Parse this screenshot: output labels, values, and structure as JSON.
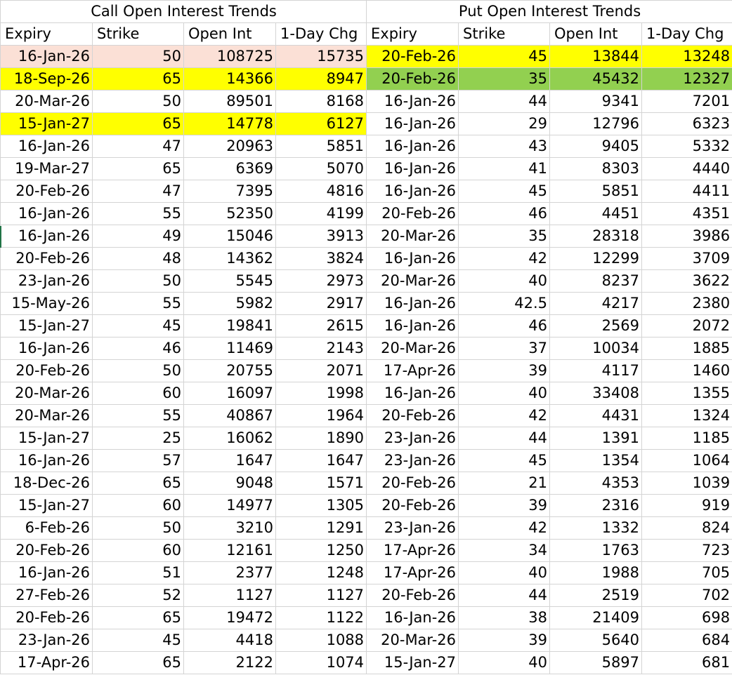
{
  "sections": {
    "call_title": "Call Open Interest Trends",
    "put_title": "Put Open Interest Trends"
  },
  "headers": {
    "call": [
      "Expiry",
      "Strike",
      "Open Int",
      "1-Day Chg"
    ],
    "put": [
      "Expiry",
      "Strike",
      "Open Int",
      "1-Day Chg"
    ]
  },
  "colors": {
    "yellow_highlight": "#ffff00",
    "pink_highlight": "#fbe0d6",
    "green_highlight": "#92d050",
    "gridline": "#d4d4d4"
  },
  "rows": [
    {
      "call": [
        "16-Jan-26",
        "50",
        "108725",
        "15735"
      ],
      "put": [
        "20-Feb-26",
        "45",
        "13844",
        "13248"
      ],
      "call_hl": "pink",
      "put_hl": "yellow"
    },
    {
      "call": [
        "18-Sep-26",
        "65",
        "14366",
        "8947"
      ],
      "put": [
        "20-Feb-26",
        "35",
        "45432",
        "12327"
      ],
      "call_hl": "yellow",
      "put_hl": "green"
    },
    {
      "call": [
        "20-Mar-26",
        "50",
        "89501",
        "8168"
      ],
      "put": [
        "16-Jan-26",
        "44",
        "9341",
        "7201"
      ],
      "call_hl": "",
      "put_hl": ""
    },
    {
      "call": [
        "15-Jan-27",
        "65",
        "14778",
        "6127"
      ],
      "put": [
        "16-Jan-26",
        "29",
        "12796",
        "6323"
      ],
      "call_hl": "yellow",
      "put_hl": ""
    },
    {
      "call": [
        "16-Jan-26",
        "47",
        "20963",
        "5851"
      ],
      "put": [
        "16-Jan-26",
        "43",
        "9405",
        "5332"
      ],
      "call_hl": "",
      "put_hl": ""
    },
    {
      "call": [
        "19-Mar-27",
        "65",
        "6369",
        "5070"
      ],
      "put": [
        "16-Jan-26",
        "41",
        "8303",
        "4440"
      ],
      "call_hl": "",
      "put_hl": ""
    },
    {
      "call": [
        "20-Feb-26",
        "47",
        "7395",
        "4816"
      ],
      "put": [
        "16-Jan-26",
        "45",
        "5851",
        "4411"
      ],
      "call_hl": "",
      "put_hl": ""
    },
    {
      "call": [
        "16-Jan-26",
        "55",
        "52350",
        "4199"
      ],
      "put": [
        "20-Feb-26",
        "46",
        "4451",
        "4351"
      ],
      "call_hl": "",
      "put_hl": ""
    },
    {
      "call": [
        "16-Jan-26",
        "49",
        "15046",
        "3913"
      ],
      "put": [
        "20-Mar-26",
        "35",
        "28318",
        "3986"
      ],
      "call_hl": "",
      "put_hl": ""
    },
    {
      "call": [
        "20-Feb-26",
        "48",
        "14362",
        "3824"
      ],
      "put": [
        "16-Jan-26",
        "42",
        "12299",
        "3709"
      ],
      "call_hl": "",
      "put_hl": ""
    },
    {
      "call": [
        "23-Jan-26",
        "50",
        "5545",
        "2973"
      ],
      "put": [
        "20-Mar-26",
        "40",
        "8237",
        "3622"
      ],
      "call_hl": "",
      "put_hl": ""
    },
    {
      "call": [
        "15-May-26",
        "55",
        "5982",
        "2917"
      ],
      "put": [
        "16-Jan-26",
        "42.5",
        "4217",
        "2380"
      ],
      "call_hl": "",
      "put_hl": ""
    },
    {
      "call": [
        "15-Jan-27",
        "45",
        "19841",
        "2615"
      ],
      "put": [
        "16-Jan-26",
        "46",
        "2569",
        "2072"
      ],
      "call_hl": "",
      "put_hl": ""
    },
    {
      "call": [
        "16-Jan-26",
        "46",
        "11469",
        "2143"
      ],
      "put": [
        "20-Mar-26",
        "37",
        "10034",
        "1885"
      ],
      "call_hl": "",
      "put_hl": ""
    },
    {
      "call": [
        "20-Feb-26",
        "50",
        "20755",
        "2071"
      ],
      "put": [
        "17-Apr-26",
        "39",
        "4117",
        "1460"
      ],
      "call_hl": "",
      "put_hl": ""
    },
    {
      "call": [
        "20-Mar-26",
        "60",
        "16097",
        "1998"
      ],
      "put": [
        "16-Jan-26",
        "40",
        "33408",
        "1355"
      ],
      "call_hl": "",
      "put_hl": ""
    },
    {
      "call": [
        "20-Mar-26",
        "55",
        "40867",
        "1964"
      ],
      "put": [
        "20-Feb-26",
        "42",
        "4431",
        "1324"
      ],
      "call_hl": "",
      "put_hl": ""
    },
    {
      "call": [
        "15-Jan-27",
        "25",
        "16062",
        "1890"
      ],
      "put": [
        "23-Jan-26",
        "44",
        "1391",
        "1185"
      ],
      "call_hl": "",
      "put_hl": ""
    },
    {
      "call": [
        "16-Jan-26",
        "57",
        "1647",
        "1647"
      ],
      "put": [
        "23-Jan-26",
        "45",
        "1354",
        "1064"
      ],
      "call_hl": "",
      "put_hl": ""
    },
    {
      "call": [
        "18-Dec-26",
        "65",
        "9048",
        "1571"
      ],
      "put": [
        "20-Feb-26",
        "21",
        "4353",
        "1039"
      ],
      "call_hl": "",
      "put_hl": ""
    },
    {
      "call": [
        "15-Jan-27",
        "60",
        "14977",
        "1305"
      ],
      "put": [
        "20-Feb-26",
        "39",
        "2316",
        "919"
      ],
      "call_hl": "",
      "put_hl": ""
    },
    {
      "call": [
        "6-Feb-26",
        "50",
        "3210",
        "1291"
      ],
      "put": [
        "23-Jan-26",
        "42",
        "1332",
        "824"
      ],
      "call_hl": "",
      "put_hl": ""
    },
    {
      "call": [
        "20-Feb-26",
        "60",
        "12161",
        "1250"
      ],
      "put": [
        "17-Apr-26",
        "34",
        "1763",
        "723"
      ],
      "call_hl": "",
      "put_hl": ""
    },
    {
      "call": [
        "16-Jan-26",
        "51",
        "2377",
        "1248"
      ],
      "put": [
        "17-Apr-26",
        "40",
        "1988",
        "705"
      ],
      "call_hl": "",
      "put_hl": ""
    },
    {
      "call": [
        "27-Feb-26",
        "52",
        "1127",
        "1127"
      ],
      "put": [
        "20-Feb-26",
        "44",
        "2519",
        "702"
      ],
      "call_hl": "",
      "put_hl": ""
    },
    {
      "call": [
        "20-Feb-26",
        "65",
        "19472",
        "1122"
      ],
      "put": [
        "16-Jan-26",
        "38",
        "21409",
        "698"
      ],
      "call_hl": "",
      "put_hl": ""
    },
    {
      "call": [
        "23-Jan-26",
        "45",
        "4418",
        "1088"
      ],
      "put": [
        "20-Mar-26",
        "39",
        "5640",
        "684"
      ],
      "call_hl": "",
      "put_hl": ""
    },
    {
      "call": [
        "17-Apr-26",
        "65",
        "2122",
        "1074"
      ],
      "put": [
        "15-Jan-27",
        "40",
        "5897",
        "681"
      ],
      "call_hl": "",
      "put_hl": ""
    }
  ]
}
